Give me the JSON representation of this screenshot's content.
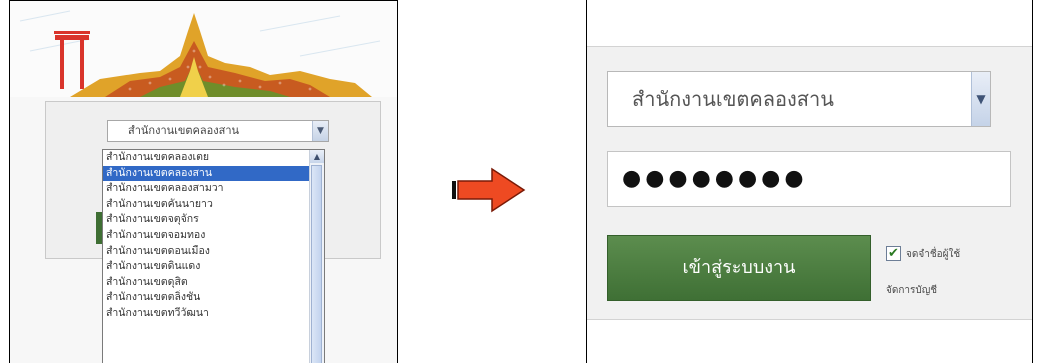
{
  "left_panel": {
    "select": {
      "value": "สำนักงานเขตคลองสาน"
    },
    "dropdown": {
      "options": [
        "สำนักงานเขตคลองเตย",
        "สำนักงานเขตคลองสาน",
        "สำนักงานเขตคลองสามวา",
        "สำนักงานเขตคันนายาว",
        "สำนักงานเขตจตุจักร",
        "สำนักงานเขตจอมทอง",
        "สำนักงานเขตดอนเมือง",
        "สำนักงานเขตดินแดง",
        "สำนักงานเขตดุสิต",
        "สำนักงานเขตตลิ่งชัน",
        "สำนักงานเขตทวีวัฒนา"
      ],
      "selected_index": 1
    }
  },
  "arrow": {
    "color": "#ee4a22"
  },
  "right_panel": {
    "select": {
      "value": "สำนักงานเขตคลองสาน"
    },
    "password": {
      "masked_value": "●●●●●●●●"
    },
    "login_button": {
      "label": "เข้าสู่ระบบงาน",
      "color": "#4b7c3f"
    },
    "remember": {
      "label": "จดจำชื่อผู้ใช้",
      "checked": true
    },
    "manage_account": {
      "label": "จัดการบัญชี"
    }
  },
  "colors": {
    "selected_option": "#3169c6"
  }
}
